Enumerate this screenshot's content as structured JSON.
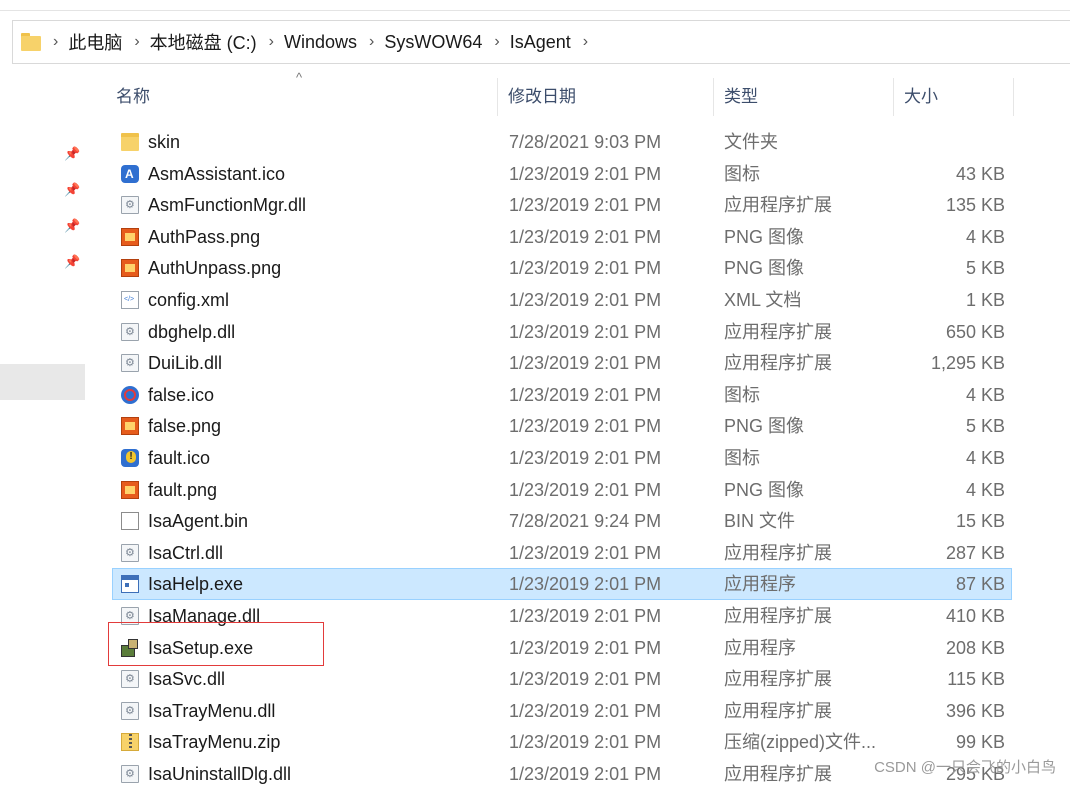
{
  "breadcrumb": [
    "此电脑",
    "本地磁盘 (C:)",
    "Windows",
    "SysWOW64",
    "IsAgent"
  ],
  "columns": {
    "name": "名称",
    "date": "修改日期",
    "type": "类型",
    "size": "大小"
  },
  "files": [
    {
      "name": "skin",
      "date": "7/28/2021 9:03 PM",
      "type": "文件夹",
      "size": "",
      "icon": "folder-icon"
    },
    {
      "name": "AsmAssistant.ico",
      "date": "1/23/2019 2:01 PM",
      "type": "图标",
      "size": "43 KB",
      "icon": "ico-icon"
    },
    {
      "name": "AsmFunctionMgr.dll",
      "date": "1/23/2019 2:01 PM",
      "type": "应用程序扩展",
      "size": "135 KB",
      "icon": "dll-icon"
    },
    {
      "name": "AuthPass.png",
      "date": "1/23/2019 2:01 PM",
      "type": "PNG 图像",
      "size": "4 KB",
      "icon": "png-icon"
    },
    {
      "name": "AuthUnpass.png",
      "date": "1/23/2019 2:01 PM",
      "type": "PNG 图像",
      "size": "5 KB",
      "icon": "png-icon"
    },
    {
      "name": "config.xml",
      "date": "1/23/2019 2:01 PM",
      "type": "XML 文档",
      "size": "1 KB",
      "icon": "xml-icon"
    },
    {
      "name": "dbghelp.dll",
      "date": "1/23/2019 2:01 PM",
      "type": "应用程序扩展",
      "size": "650 KB",
      "icon": "dll-icon"
    },
    {
      "name": "DuiLib.dll",
      "date": "1/23/2019 2:01 PM",
      "type": "应用程序扩展",
      "size": "1,295 KB",
      "icon": "dll-icon"
    },
    {
      "name": "false.ico",
      "date": "1/23/2019 2:01 PM",
      "type": "图标",
      "size": "4 KB",
      "icon": "false-ico-icon"
    },
    {
      "name": "false.png",
      "date": "1/23/2019 2:01 PM",
      "type": "PNG 图像",
      "size": "5 KB",
      "icon": "png-icon"
    },
    {
      "name": "fault.ico",
      "date": "1/23/2019 2:01 PM",
      "type": "图标",
      "size": "4 KB",
      "icon": "fault-ico-icon"
    },
    {
      "name": "fault.png",
      "date": "1/23/2019 2:01 PM",
      "type": "PNG 图像",
      "size": "4 KB",
      "icon": "png-icon"
    },
    {
      "name": "IsaAgent.bin",
      "date": "7/28/2021 9:24 PM",
      "type": "BIN 文件",
      "size": "15 KB",
      "icon": "bin-icon"
    },
    {
      "name": "IsaCtrl.dll",
      "date": "1/23/2019 2:01 PM",
      "type": "应用程序扩展",
      "size": "287 KB",
      "icon": "dll-icon"
    },
    {
      "name": "IsaHelp.exe",
      "date": "1/23/2019 2:01 PM",
      "type": "应用程序",
      "size": "87 KB",
      "icon": "exe-icon",
      "selected": true
    },
    {
      "name": "IsaManage.dll",
      "date": "1/23/2019 2:01 PM",
      "type": "应用程序扩展",
      "size": "410 KB",
      "icon": "dll-icon"
    },
    {
      "name": "IsaSetup.exe",
      "date": "1/23/2019 2:01 PM",
      "type": "应用程序",
      "size": "208 KB",
      "icon": "setup-icon"
    },
    {
      "name": "IsaSvc.dll",
      "date": "1/23/2019 2:01 PM",
      "type": "应用程序扩展",
      "size": "115 KB",
      "icon": "dll-icon"
    },
    {
      "name": "IsaTrayMenu.dll",
      "date": "1/23/2019 2:01 PM",
      "type": "应用程序扩展",
      "size": "396 KB",
      "icon": "dll-icon"
    },
    {
      "name": "IsaTrayMenu.zip",
      "date": "1/23/2019 2:01 PM",
      "type": "压缩(zipped)文件...",
      "size": "99 KB",
      "icon": "zip-icon"
    },
    {
      "name": "IsaUninstallDlg.dll",
      "date": "1/23/2019 2:01 PM",
      "type": "应用程序扩展",
      "size": "295 KB",
      "icon": "dll-icon"
    }
  ],
  "watermark": "CSDN @一只会飞的小白鸟"
}
